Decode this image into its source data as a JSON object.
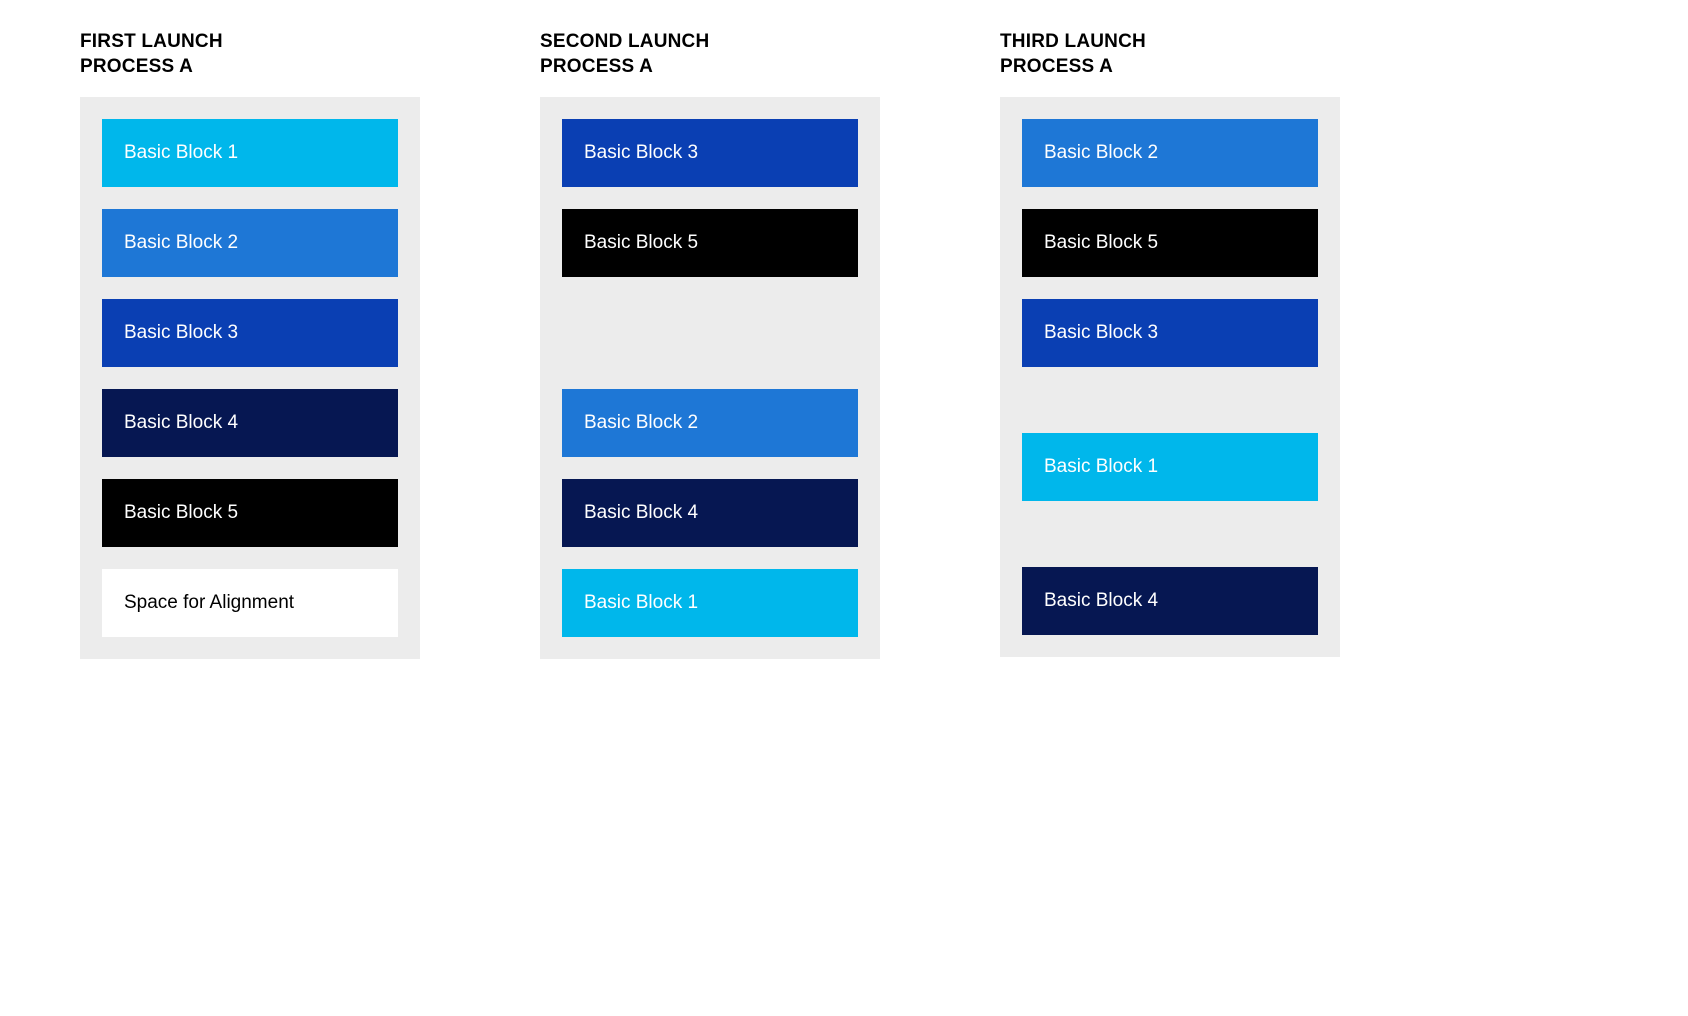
{
  "columns": [
    {
      "headingLine1": "FIRST LAUNCH",
      "headingLine2": "PROCESS A",
      "blocks": [
        {
          "label": "Basic Block 1",
          "type": "1",
          "spacer": false
        },
        {
          "label": "Basic Block 2",
          "type": "2",
          "spacer": false
        },
        {
          "label": "Basic Block 3",
          "type": "3",
          "spacer": false
        },
        {
          "label": "Basic Block 4",
          "type": "4",
          "spacer": false
        },
        {
          "label": "Basic Block 5",
          "type": "5",
          "spacer": false
        },
        {
          "label": "Space for Alignment",
          "type": "align",
          "spacer": false
        }
      ]
    },
    {
      "headingLine1": "SECOND LAUNCH",
      "headingLine2": "PROCESS A",
      "blocks": [
        {
          "label": "Basic Block 3",
          "type": "3",
          "spacer": false
        },
        {
          "label": "Basic Block 5",
          "type": "5",
          "spacer": false
        },
        {
          "label": "",
          "type": "",
          "spacer": true
        },
        {
          "label": "Basic Block 2",
          "type": "2",
          "spacer": false
        },
        {
          "label": "Basic Block 4",
          "type": "4",
          "spacer": false
        },
        {
          "label": "Basic Block 1",
          "type": "1",
          "spacer": false
        }
      ]
    },
    {
      "headingLine1": "THIRD LAUNCH",
      "headingLine2": "PROCESS A",
      "blocks": [
        {
          "label": "Basic Block 2",
          "type": "2",
          "spacer": false
        },
        {
          "label": "Basic Block 5",
          "type": "5",
          "spacer": false
        },
        {
          "label": "Basic Block 3",
          "type": "3",
          "spacer": false
        },
        {
          "label": "",
          "type": "",
          "spacer": true
        },
        {
          "label": "Basic Block 1",
          "type": "1",
          "spacer": false
        },
        {
          "label": "",
          "type": "",
          "spacer": true
        },
        {
          "label": "Basic Block 4",
          "type": "4",
          "spacer": false
        }
      ]
    }
  ]
}
